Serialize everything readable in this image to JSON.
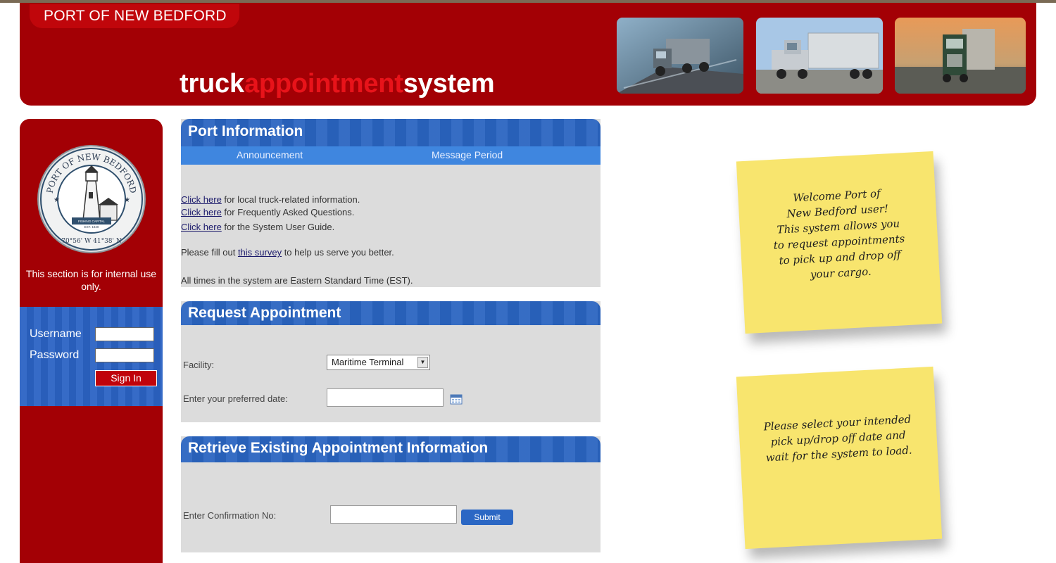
{
  "header": {
    "port_name": "PORT OF NEW BEDFORD",
    "title_part1": "truck",
    "title_part2": "appointment",
    "title_part3": "system",
    "photos": [
      "truck-photo-1",
      "truck-photo-2",
      "truck-photo-3"
    ]
  },
  "sidebar": {
    "seal": {
      "top_text": "PORT OF NEW BEDFORD",
      "bottom_text": "70°56' W  41°38' N",
      "small_text_1": "FISHING CAPITAL",
      "small_text_2": "EST. 1840"
    },
    "internal_notice": "This section is for internal use only.",
    "username_label": "Username",
    "password_label": "Password",
    "sign_in_label": "Sign In"
  },
  "port_info": {
    "title": "Port Information",
    "col_announcement": "Announcement",
    "col_message_period": "Message Period",
    "line1_link": "Click here",
    "line1_text": " for local truck-related information.",
    "line2_link": "Click here",
    "line2_text": " for Frequently Asked Questions.",
    "line3_link": "Click here",
    "line3_text": " for the System User Guide.",
    "survey_prefix": "Please fill out ",
    "survey_link": "this survey",
    "survey_suffix": " to help us serve you better.",
    "timezone_note": "All times in the system are Eastern Standard Time (EST)."
  },
  "request": {
    "title": "Request Appointment",
    "facility_label": "Facility:",
    "facility_value": "Maritime Terminal",
    "date_label": "Enter your preferred date:",
    "date_value": ""
  },
  "retrieve": {
    "title": "Retrieve Existing Appointment Information",
    "confirmation_label": "Enter Confirmation No:",
    "confirmation_value": "",
    "submit_label": "Submit"
  },
  "notes": {
    "welcome": "Welcome Port of\nNew Bedford user!\nThis system allows you\nto request appointments\nto pick up and drop off\nyour cargo.",
    "instructions": "Please select your intended\npick up/drop off date and\nwait for the system to load."
  },
  "colors": {
    "brand_red": "#a30005",
    "accent_red": "#e8131a",
    "panel_blue": "#2a64c0",
    "note_yellow": "#f8e56e"
  }
}
